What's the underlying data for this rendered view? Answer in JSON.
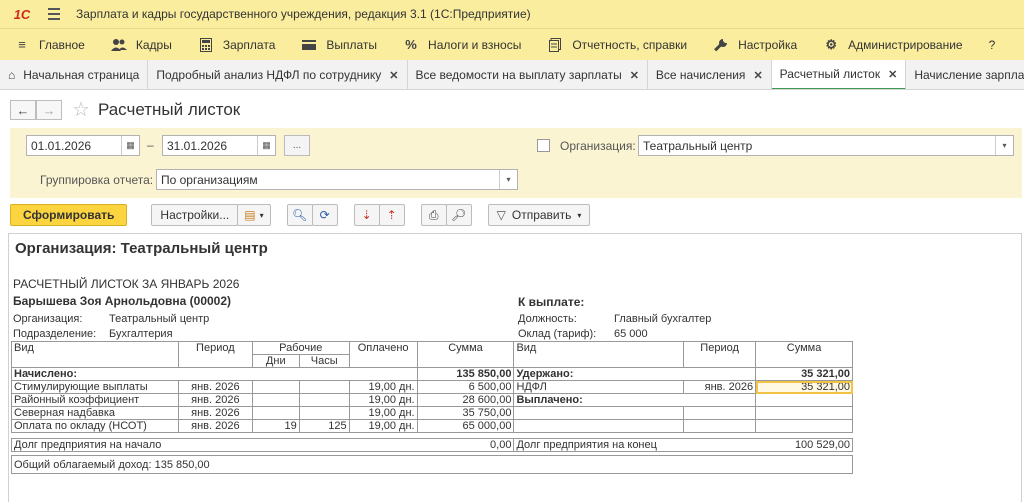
{
  "app": {
    "logo": "1С",
    "title": "Зарплата и кадры государственного учреждения, редакция 3.1  (1С:Предприятие)"
  },
  "menu": [
    {
      "icon": "hamburger-icon",
      "label": "Главное"
    },
    {
      "icon": "users-icon",
      "label": "Кадры"
    },
    {
      "icon": "calculator-icon",
      "label": "Зарплата"
    },
    {
      "icon": "wallet-icon",
      "label": "Выплаты"
    },
    {
      "icon": "percent-icon",
      "label": "Налоги и взносы"
    },
    {
      "icon": "report-icon",
      "label": "Отчетность, справки"
    },
    {
      "icon": "wrench-icon",
      "label": "Настройка"
    },
    {
      "icon": "gear-icon",
      "label": "Администрирование"
    },
    {
      "icon": "help-icon",
      "label": "?"
    }
  ],
  "tabs": [
    {
      "label": "Начальная страница",
      "closable": false
    },
    {
      "label": "Подробный анализ НДФЛ по сотруднику",
      "closable": true
    },
    {
      "label": "Все ведомости на выплату зарплаты",
      "closable": true
    },
    {
      "label": "Все начисления",
      "closable": true
    },
    {
      "label": "Расчетный листок",
      "closable": true,
      "active": true
    },
    {
      "label": "Начисление зарплаты",
      "closable": false
    }
  ],
  "form": {
    "title": "Расчетный листок",
    "date_from": "01.01.2026",
    "date_dash": "–",
    "date_to": "31.01.2026",
    "dots": "...",
    "org_label": "Организация:",
    "org_value": "Театральный центр",
    "grouping_label": "Группировка отчета:",
    "grouping_value": "По организациям"
  },
  "toolbar": {
    "generate": "Сформировать",
    "settings": "Настройки...",
    "send": "Отправить"
  },
  "report": {
    "org_header": "Организация: Театральный центр",
    "title": "РАСЧЕТНЫЙ ЛИСТОК ЗА ЯНВАРЬ 2026",
    "employee": "Барышева Зоя Арнольдовна (00002)",
    "org_label": "Организация:",
    "org_value": "Театральный центр",
    "dept_label": "Подразделение:",
    "dept_value": "Бухгалтерия",
    "to_pay_label": "К выплате:",
    "position_label": "Должность:",
    "position_value": "Главный бухгалтер",
    "salary_label": "Оклад (тариф):",
    "salary_value": "65 000",
    "headers": {
      "kind": "Вид",
      "period": "Период",
      "worked": "Рабочие",
      "days": "Дни",
      "hours": "Часы",
      "paid": "Оплачено",
      "sum": "Сумма"
    },
    "accrued_label": "Начислено:",
    "accrued_total": "135 850,00",
    "withheld_label": "Удержано:",
    "withheld_total": "35 321,00",
    "paid_out_label": "Выплачено:",
    "accruals": [
      {
        "kind": "Стимулирующие выплаты",
        "period": "янв. 2026",
        "days": "",
        "hours": "",
        "paid": "19,00 дн.",
        "sum": "6 500,00"
      },
      {
        "kind": "Районный коэффициент",
        "period": "янв. 2026",
        "days": "",
        "hours": "",
        "paid": "19,00 дн.",
        "sum": "28 600,00"
      },
      {
        "kind": "Северная надбавка",
        "period": "янв. 2026",
        "days": "",
        "hours": "",
        "paid": "19,00 дн.",
        "sum": "35 750,00"
      },
      {
        "kind": "Оплата по окладу (НСОТ)",
        "period": "янв. 2026",
        "days": "19",
        "hours": "125",
        "paid": "19,00 дн.",
        "sum": "65 000,00"
      }
    ],
    "deductions": [
      {
        "kind": "НДФЛ",
        "period": "янв. 2026",
        "sum": "35 321,00"
      }
    ],
    "debt_start_label": "Долг предприятия на начало",
    "debt_start_value": "0,00",
    "debt_end_label": "Долг предприятия на конец",
    "debt_end_value": "100 529,00",
    "taxable_income": "Общий облагаемый доход: 135 850,00"
  }
}
